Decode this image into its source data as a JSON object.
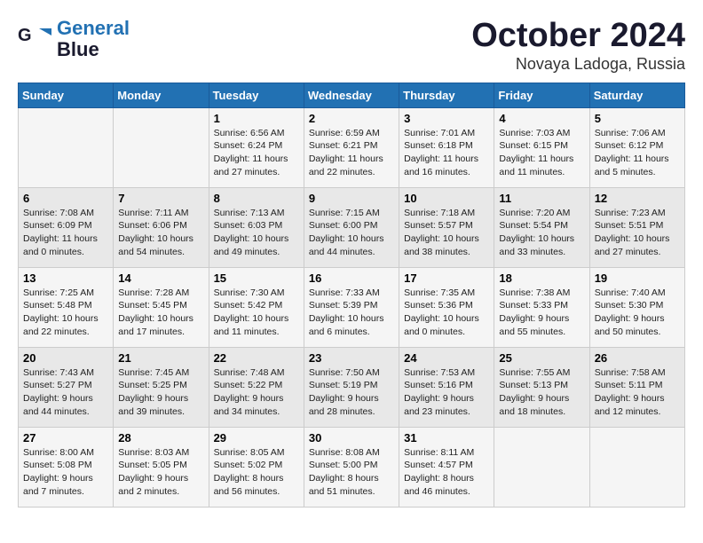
{
  "header": {
    "logo_line1": "General",
    "logo_line2": "Blue",
    "month": "October 2024",
    "location": "Novaya Ladoga, Russia"
  },
  "weekdays": [
    "Sunday",
    "Monday",
    "Tuesday",
    "Wednesday",
    "Thursday",
    "Friday",
    "Saturday"
  ],
  "weeks": [
    [
      {
        "day": "",
        "sunrise": "",
        "sunset": "",
        "daylight": ""
      },
      {
        "day": "",
        "sunrise": "",
        "sunset": "",
        "daylight": ""
      },
      {
        "day": "1",
        "sunrise": "Sunrise: 6:56 AM",
        "sunset": "Sunset: 6:24 PM",
        "daylight": "Daylight: 11 hours and 27 minutes."
      },
      {
        "day": "2",
        "sunrise": "Sunrise: 6:59 AM",
        "sunset": "Sunset: 6:21 PM",
        "daylight": "Daylight: 11 hours and 22 minutes."
      },
      {
        "day": "3",
        "sunrise": "Sunrise: 7:01 AM",
        "sunset": "Sunset: 6:18 PM",
        "daylight": "Daylight: 11 hours and 16 minutes."
      },
      {
        "day": "4",
        "sunrise": "Sunrise: 7:03 AM",
        "sunset": "Sunset: 6:15 PM",
        "daylight": "Daylight: 11 hours and 11 minutes."
      },
      {
        "day": "5",
        "sunrise": "Sunrise: 7:06 AM",
        "sunset": "Sunset: 6:12 PM",
        "daylight": "Daylight: 11 hours and 5 minutes."
      }
    ],
    [
      {
        "day": "6",
        "sunrise": "Sunrise: 7:08 AM",
        "sunset": "Sunset: 6:09 PM",
        "daylight": "Daylight: 11 hours and 0 minutes."
      },
      {
        "day": "7",
        "sunrise": "Sunrise: 7:11 AM",
        "sunset": "Sunset: 6:06 PM",
        "daylight": "Daylight: 10 hours and 54 minutes."
      },
      {
        "day": "8",
        "sunrise": "Sunrise: 7:13 AM",
        "sunset": "Sunset: 6:03 PM",
        "daylight": "Daylight: 10 hours and 49 minutes."
      },
      {
        "day": "9",
        "sunrise": "Sunrise: 7:15 AM",
        "sunset": "Sunset: 6:00 PM",
        "daylight": "Daylight: 10 hours and 44 minutes."
      },
      {
        "day": "10",
        "sunrise": "Sunrise: 7:18 AM",
        "sunset": "Sunset: 5:57 PM",
        "daylight": "Daylight: 10 hours and 38 minutes."
      },
      {
        "day": "11",
        "sunrise": "Sunrise: 7:20 AM",
        "sunset": "Sunset: 5:54 PM",
        "daylight": "Daylight: 10 hours and 33 minutes."
      },
      {
        "day": "12",
        "sunrise": "Sunrise: 7:23 AM",
        "sunset": "Sunset: 5:51 PM",
        "daylight": "Daylight: 10 hours and 27 minutes."
      }
    ],
    [
      {
        "day": "13",
        "sunrise": "Sunrise: 7:25 AM",
        "sunset": "Sunset: 5:48 PM",
        "daylight": "Daylight: 10 hours and 22 minutes."
      },
      {
        "day": "14",
        "sunrise": "Sunrise: 7:28 AM",
        "sunset": "Sunset: 5:45 PM",
        "daylight": "Daylight: 10 hours and 17 minutes."
      },
      {
        "day": "15",
        "sunrise": "Sunrise: 7:30 AM",
        "sunset": "Sunset: 5:42 PM",
        "daylight": "Daylight: 10 hours and 11 minutes."
      },
      {
        "day": "16",
        "sunrise": "Sunrise: 7:33 AM",
        "sunset": "Sunset: 5:39 PM",
        "daylight": "Daylight: 10 hours and 6 minutes."
      },
      {
        "day": "17",
        "sunrise": "Sunrise: 7:35 AM",
        "sunset": "Sunset: 5:36 PM",
        "daylight": "Daylight: 10 hours and 0 minutes."
      },
      {
        "day": "18",
        "sunrise": "Sunrise: 7:38 AM",
        "sunset": "Sunset: 5:33 PM",
        "daylight": "Daylight: 9 hours and 55 minutes."
      },
      {
        "day": "19",
        "sunrise": "Sunrise: 7:40 AM",
        "sunset": "Sunset: 5:30 PM",
        "daylight": "Daylight: 9 hours and 50 minutes."
      }
    ],
    [
      {
        "day": "20",
        "sunrise": "Sunrise: 7:43 AM",
        "sunset": "Sunset: 5:27 PM",
        "daylight": "Daylight: 9 hours and 44 minutes."
      },
      {
        "day": "21",
        "sunrise": "Sunrise: 7:45 AM",
        "sunset": "Sunset: 5:25 PM",
        "daylight": "Daylight: 9 hours and 39 minutes."
      },
      {
        "day": "22",
        "sunrise": "Sunrise: 7:48 AM",
        "sunset": "Sunset: 5:22 PM",
        "daylight": "Daylight: 9 hours and 34 minutes."
      },
      {
        "day": "23",
        "sunrise": "Sunrise: 7:50 AM",
        "sunset": "Sunset: 5:19 PM",
        "daylight": "Daylight: 9 hours and 28 minutes."
      },
      {
        "day": "24",
        "sunrise": "Sunrise: 7:53 AM",
        "sunset": "Sunset: 5:16 PM",
        "daylight": "Daylight: 9 hours and 23 minutes."
      },
      {
        "day": "25",
        "sunrise": "Sunrise: 7:55 AM",
        "sunset": "Sunset: 5:13 PM",
        "daylight": "Daylight: 9 hours and 18 minutes."
      },
      {
        "day": "26",
        "sunrise": "Sunrise: 7:58 AM",
        "sunset": "Sunset: 5:11 PM",
        "daylight": "Daylight: 9 hours and 12 minutes."
      }
    ],
    [
      {
        "day": "27",
        "sunrise": "Sunrise: 8:00 AM",
        "sunset": "Sunset: 5:08 PM",
        "daylight": "Daylight: 9 hours and 7 minutes."
      },
      {
        "day": "28",
        "sunrise": "Sunrise: 8:03 AM",
        "sunset": "Sunset: 5:05 PM",
        "daylight": "Daylight: 9 hours and 2 minutes."
      },
      {
        "day": "29",
        "sunrise": "Sunrise: 8:05 AM",
        "sunset": "Sunset: 5:02 PM",
        "daylight": "Daylight: 8 hours and 56 minutes."
      },
      {
        "day": "30",
        "sunrise": "Sunrise: 8:08 AM",
        "sunset": "Sunset: 5:00 PM",
        "daylight": "Daylight: 8 hours and 51 minutes."
      },
      {
        "day": "31",
        "sunrise": "Sunrise: 8:11 AM",
        "sunset": "Sunset: 4:57 PM",
        "daylight": "Daylight: 8 hours and 46 minutes."
      },
      {
        "day": "",
        "sunrise": "",
        "sunset": "",
        "daylight": ""
      },
      {
        "day": "",
        "sunrise": "",
        "sunset": "",
        "daylight": ""
      }
    ]
  ]
}
